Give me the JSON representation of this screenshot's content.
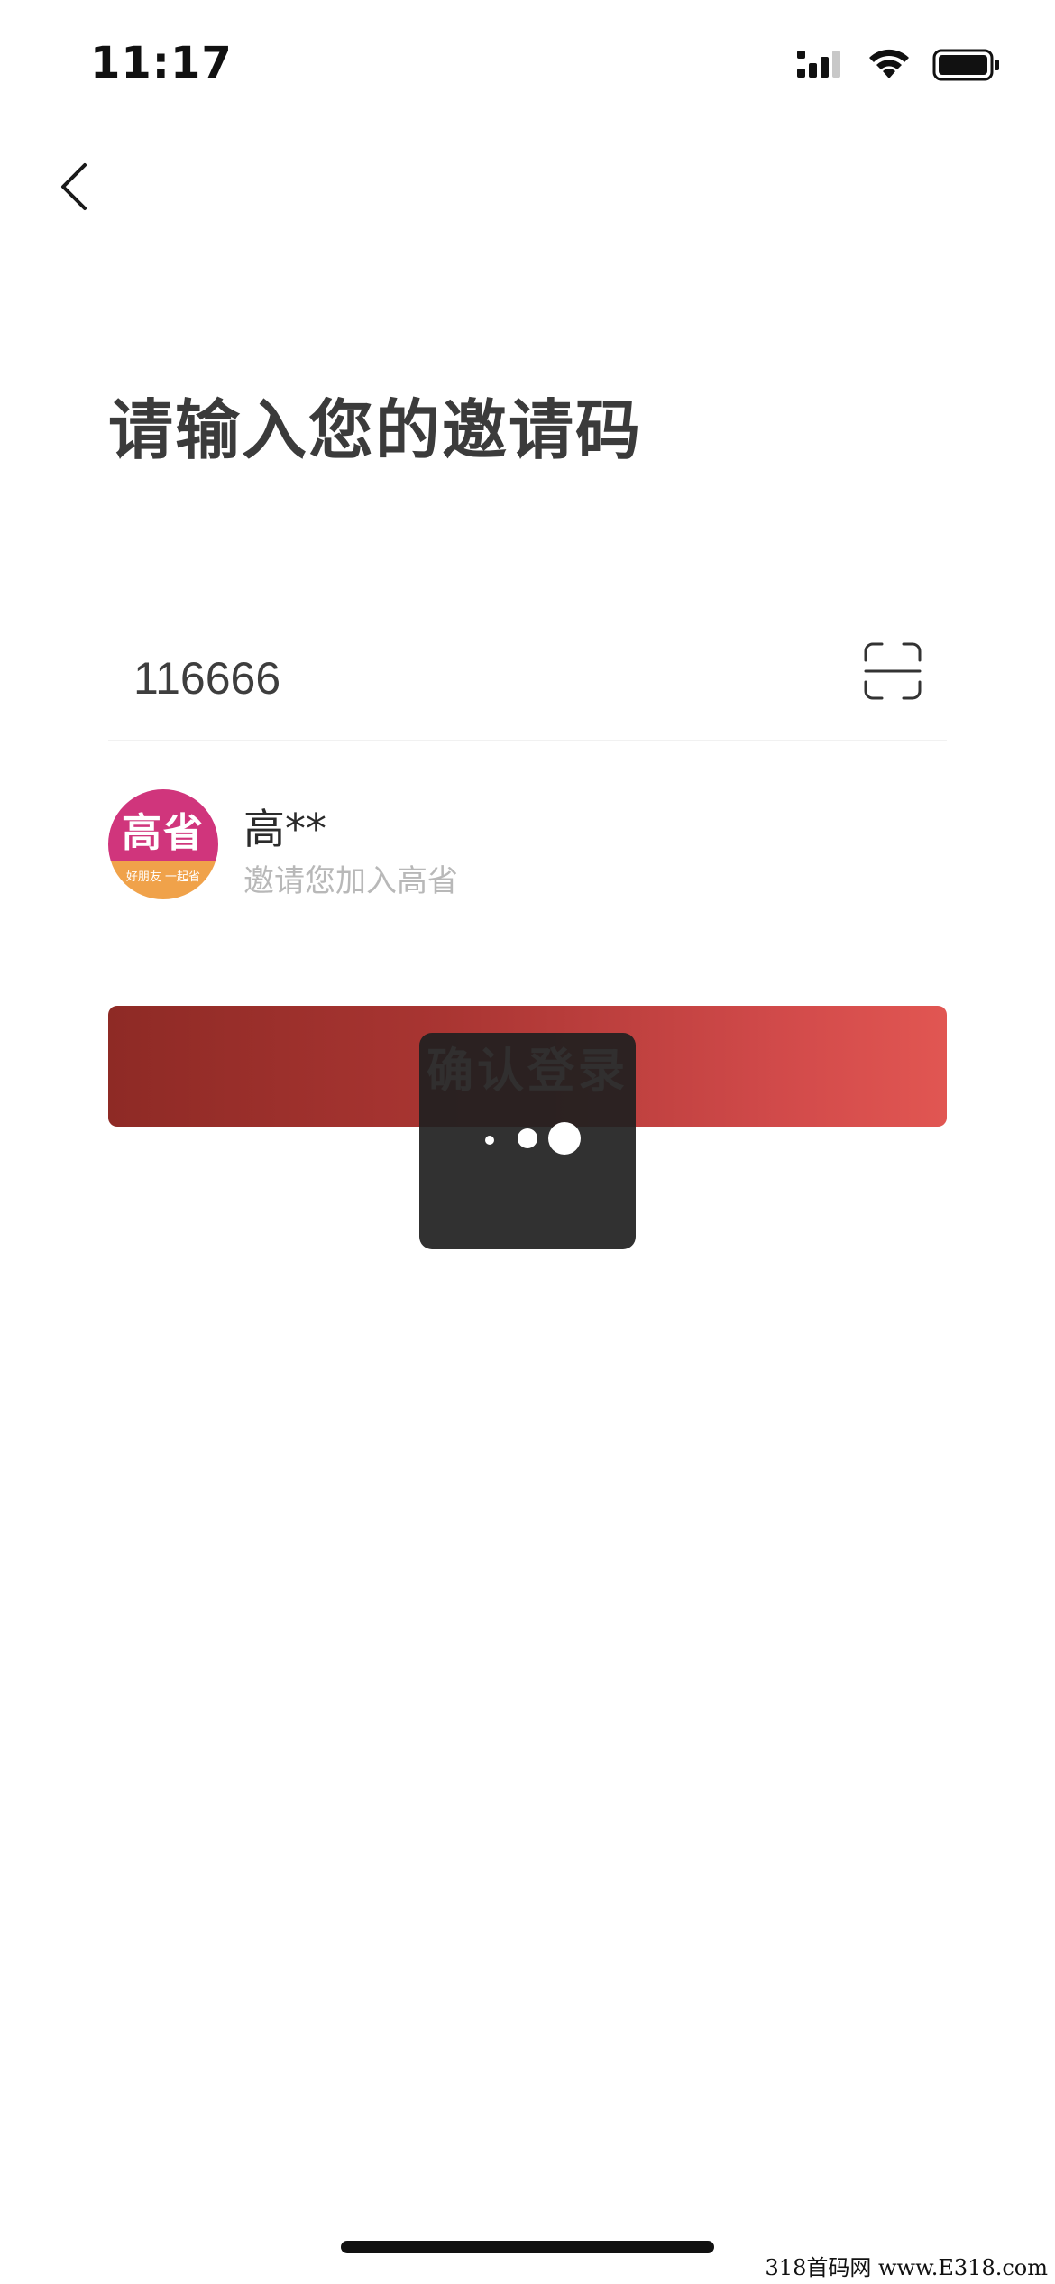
{
  "status_bar": {
    "time": "11:17",
    "icons": [
      "cellular-signal-icon",
      "wifi-icon",
      "battery-icon"
    ]
  },
  "nav": {
    "back_icon": "chevron-left-icon"
  },
  "page": {
    "title": "请输入您的邀请码"
  },
  "invite": {
    "code_value": "116666",
    "scan_icon": "scan-frame-icon"
  },
  "inviter": {
    "avatar_brand": "高省",
    "avatar_tagline": "好朋友 一起省",
    "name": "高**",
    "message": "邀请您加入高省"
  },
  "actions": {
    "confirm_label": "确认登录"
  },
  "loading": {
    "visible": true
  },
  "colors": {
    "button_start": "#8e2a25",
    "button_end": "#e15652",
    "avatar_top": "#d0357c",
    "avatar_bottom": "#f0a24a",
    "title": "#3b3b3b",
    "hint": "#b8b8b8"
  },
  "watermark": {
    "text": "318首码网 www.E318.com"
  }
}
